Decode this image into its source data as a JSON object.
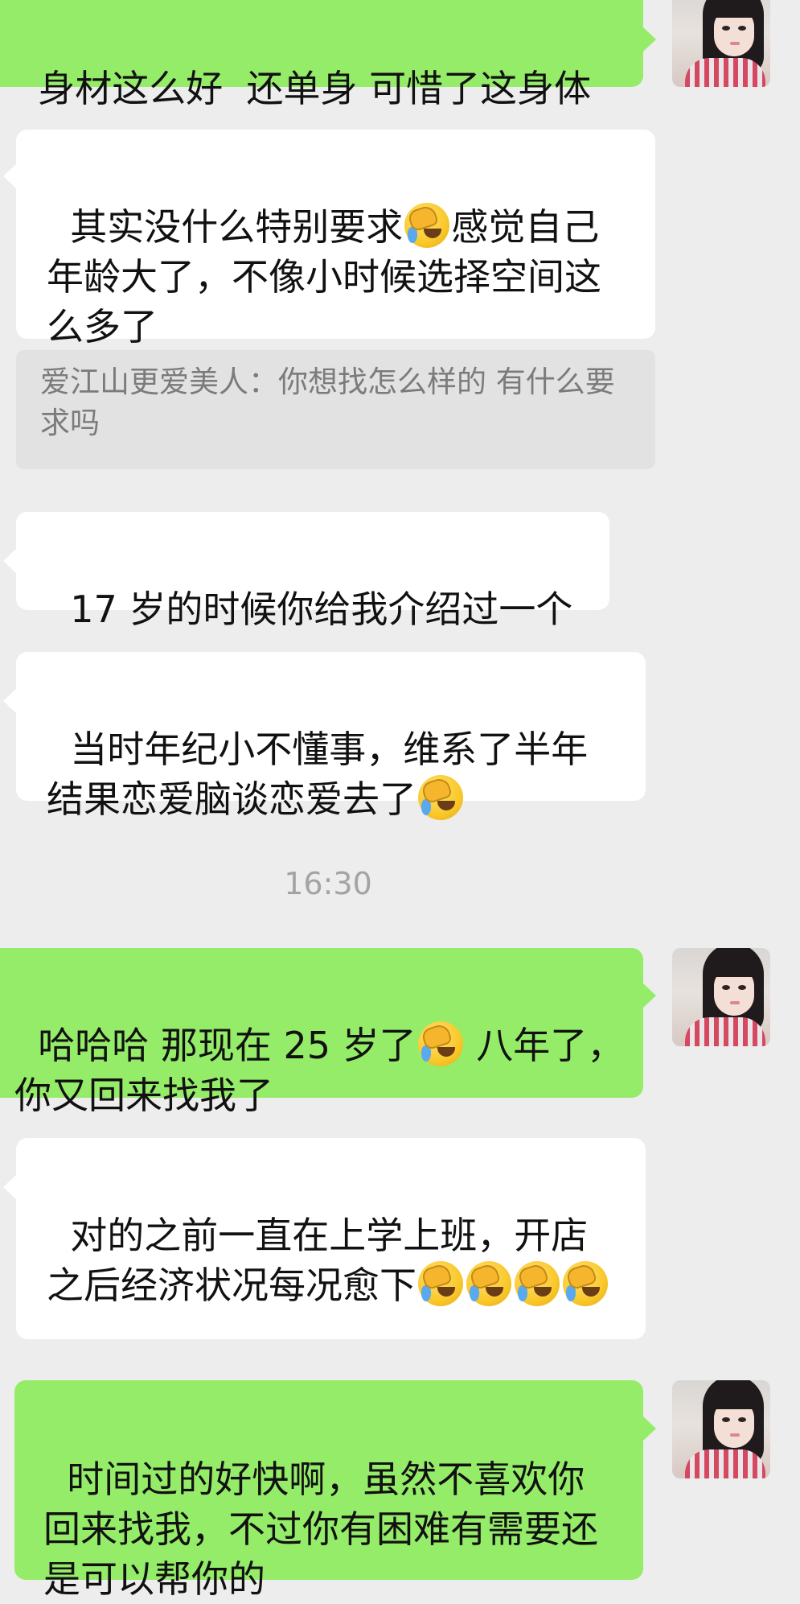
{
  "chat": {
    "messages": [
      {
        "side": "sent",
        "text": "身材这么好  还单身 可惜了这身体"
      },
      {
        "side": "received",
        "text": "其实没什么特别要求{e}感觉自己年龄大了，不像小时候选择空间这么多了"
      },
      {
        "side": "quote",
        "text": "爱江山更爱美人：你想找怎么样的 有什么要求吗"
      },
      {
        "side": "received",
        "text": "17 岁的时候你给我介绍过一个"
      },
      {
        "side": "received",
        "text": "当时年纪小不懂事，维系了半年结果恋爱脑谈恋爱去了{e}"
      },
      {
        "side": "time",
        "text": "16:30"
      },
      {
        "side": "sent",
        "text": "哈哈哈 那现在 25 岁了{e} 八年了，你又回来找我了"
      },
      {
        "side": "received",
        "text": "对的之前一直在上学上班，开店之后经济状况每况愈下{e}{e}{e}{e}"
      },
      {
        "side": "sent",
        "text": "时间过的好快啊，虽然不喜欢你回来找我，不过你有困难有需要还是可以帮你的"
      }
    ]
  },
  "icons": {
    "emoji": "facepalm-crying-emoji",
    "avatar": "avatar-photo"
  },
  "colors": {
    "background": "#ededed",
    "sent_bubble": "#95ec69",
    "received_bubble": "#ffffff",
    "quote_bubble": "#e2e2e2",
    "timestamp": "#a3a3a3"
  }
}
